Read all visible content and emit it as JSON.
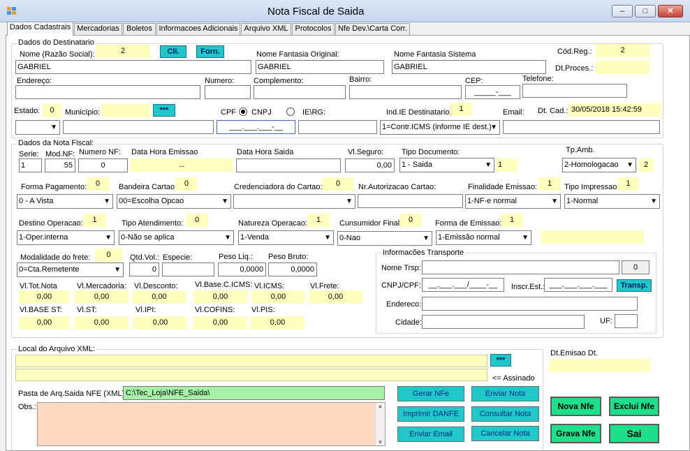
{
  "window": {
    "title": "Nota Fiscal de Saida",
    "min": "–",
    "max": "□",
    "close": "✕"
  },
  "tabs": [
    "Dados Cadastrais",
    "Mercadorias",
    "Boletos",
    "Informacoes Adicionais",
    "Arquivo XML",
    "Protocolos",
    "Nfe Dev.\\Carta Corr."
  ],
  "destinatario": {
    "group": "Dados do Destinatario",
    "nome_label": "Nome (Razão Social):",
    "nome_code": "2",
    "cli_btn": "Cli.",
    "forn_btn": "Forn.",
    "fantasia_orig_label": "Nome Fantasia Original:",
    "fantasia_sis_label": "Nome Fantasia Sistema",
    "codreg_label": "Cód.Reg.:",
    "codreg": "2",
    "dtproces_label": "Dt.Proces.:",
    "nome": "GABRIEL",
    "fantasia_orig": "GABRIEL",
    "fantasia_sis": "GABRIEL",
    "endereco_label": "Endereço:",
    "numero_label": "Numero:",
    "complemento_label": "Complemento:",
    "bairro_label": "Bairro:",
    "cep_label": "CEP:",
    "cep": "_____-___",
    "telefone_label": "Telefone:",
    "estado_label": "Estado:",
    "estado_code": "0",
    "municipio_label": "Município:",
    "mun_btn": "***",
    "cpf_label": "CPF",
    "cnpj_label": "CNPJ",
    "cpf_mask": "___.___.___-__",
    "ie_label": "IE\\RG:",
    "indie_label": "Ind.IE Destinatario:",
    "indie_code": "1",
    "indie": "1=Contr.ICMS (informe IE dest.)",
    "email_label": "Email:",
    "dtcad_label": "Dt. Cad.:",
    "dtcad": "30/05/2018 15:42:59"
  },
  "nota": {
    "group": "Dados da Nota Fiscal:",
    "serie_label": "Serie:",
    "serie": "1",
    "modnf_label": "Mod.NF:",
    "modnf": "55",
    "numero_label": "Numero NF:",
    "numero": "0",
    "dhemissao_label": "Data Hora Emissao",
    "dhemissao": "...",
    "dhsaida_label": "Data Hora Saida",
    "vlseguro_label": "Vl.Seguro:",
    "vlseguro": "0,00",
    "tipodoc_label": "Tipo Documento:",
    "tipodoc": "1 - Saida",
    "tipodoc_code": "1",
    "tpamb_label": "Tp.Amb.",
    "tpamb": "2-Homologacao",
    "tpamb_code": "2",
    "formapag_label": "Forma Pagamento:",
    "formapag_code": "0",
    "formapag": "0 - A Vista",
    "bandeira_label": "Bandeira Cartao:",
    "bandeira_code": "0",
    "bandeira": "00=Escolha Opcao",
    "credenciadora_label": "Credenciadora do Cartao:",
    "credenciadora_code": "0",
    "nraut_label": "Nr.Autorizacao Cartao:",
    "finalidade_label": "Finalidade Emissao:",
    "finalidade_code": "1",
    "finalidade": "1-NF-e normal",
    "tipoimp_label": "Tipo Impressao:",
    "tipoimp_code": "1",
    "tipoimp": "1-Normal",
    "destino_label": "Destino Operacao:",
    "destino_code": "1",
    "destino": "1-Oper.interna",
    "tipoatend_label": "Tipo Atendimento:",
    "tipoatend_code": "0",
    "tipoatend": "0-Não se aplica",
    "natureza_label": "Natureza Operacao:",
    "natureza_code": "1",
    "natureza": "1-Venda",
    "consumidor_label": "Cunsumidor Final:",
    "consumidor_code": "0",
    "consumidor": "0-Nao",
    "formaemi_label": "Forma de Emissao:",
    "formaemi_code": "1",
    "formaemi": "1-Emissão normal",
    "modfrete_label": "Modalidade do frete:",
    "modfrete_code": "0",
    "modfrete": "0=Cta.Remetente",
    "qtdvol_label": "Qtd.Vol.:",
    "qtdvol": "0",
    "especie_label": "Especie:",
    "pesoliq_label": "Peso Liq.:",
    "pesoliq": "0,0000",
    "pesobruto_label": "Peso Bruto:",
    "pesobruto": "0,0000"
  },
  "totais": [
    {
      "label": "Vl.Tot.Nota",
      "value": "0,00"
    },
    {
      "label": "Vl.Mercadoria:",
      "value": "0,00"
    },
    {
      "label": "Vl.Desconto:",
      "value": "0,00"
    },
    {
      "label": "Vl.Base.C.ICMS:",
      "value": "0,00"
    },
    {
      "label": "Vl.ICMS:",
      "value": "0,00"
    },
    {
      "label": "Vl.Frete:",
      "value": "0,00"
    },
    {
      "label": "Vl.BASE ST:",
      "value": "0,00"
    },
    {
      "label": "Vl.ST:",
      "value": "0,00"
    },
    {
      "label": "Vl.IPI:",
      "value": "0,00"
    },
    {
      "label": "Vl.COFINS:",
      "value": "0,00"
    },
    {
      "label": "Vl.PIS:",
      "value": "0,00"
    }
  ],
  "transporte": {
    "group": "Informacões Transporte",
    "nome_label": "Nome Trsp:",
    "code": "0",
    "cnpj_label": "CNPJ/CPF:",
    "cnpj_mask": "__.___.___/____-__",
    "inscr_label": "Inscr.Est.:",
    "inscr_mask": "___.___.___.___",
    "transp_btn": "Transp.",
    "endereco_label": "Endereco:",
    "cidade_label": "Cidade:",
    "uf_label": "UF:"
  },
  "xml": {
    "group": "Local do Arquivo XML:",
    "btn": "***",
    "assinado": "<= Assinado",
    "pasta_label": "Pasta de Arq.Saida NFE (XML):",
    "pasta": "C:\\Tec_Loja\\NFE_Saida\\",
    "obs_label": "Obs.:",
    "dtemissao_label": "Dt.Emisao Dt."
  },
  "actions": {
    "gerar": "Gerar NFe",
    "enviar": "Enviar Nota",
    "imprimir": "Imprimir DANFE",
    "consultar": "Consultar Nota",
    "email": "Enviar Email",
    "cancelar": "Cancelar Nota",
    "nova": "Nova Nfe",
    "exclui": "Exclui Nfe",
    "grava": "Grava Nfe",
    "sai": "Sai"
  },
  "colors": {
    "yellow_field": "#ffffc0",
    "cyan_button": "#20c8c8",
    "green_button": "#1ee08a",
    "path_green": "#a8f0a8",
    "obs_peach": "#ffd8c0"
  },
  "icons": [
    "app-icon",
    "minimize-icon",
    "maximize-icon",
    "close-icon",
    "dropdown-arrow-icon",
    "radio-icon",
    "scroll-arrow-icon"
  ]
}
